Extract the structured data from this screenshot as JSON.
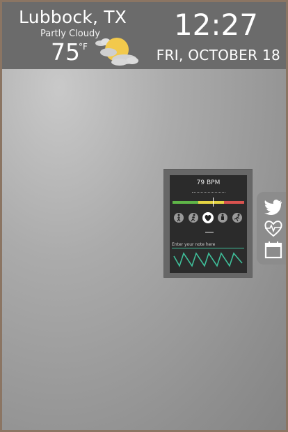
{
  "weather": {
    "city": "Lubbock, TX",
    "condition": "Partly Cloudy",
    "temperature": "75",
    "unit": "°F",
    "icon": "partly-cloudy-icon"
  },
  "clock": {
    "time": "12:27",
    "date": "FRI, OCTOBER 18"
  },
  "heart_widget": {
    "bpm_text": "79 BPM",
    "note_placeholder": "Enter your note here",
    "activities": [
      "walk-icon",
      "run-icon",
      "heart-icon",
      "sit-icon",
      "sprint-icon"
    ],
    "selected_activity": 2,
    "meter_colors": [
      "#5fb548",
      "#e5d443",
      "#d9534f"
    ]
  },
  "side_menu": {
    "items": [
      "twitter-icon",
      "heart-monitor-icon",
      "calendar-icon"
    ]
  },
  "colors": {
    "topbar": "#6b6b6b",
    "frame": "#8b7563",
    "sun": "#f2c94c",
    "wave": "#3fbf9a"
  }
}
